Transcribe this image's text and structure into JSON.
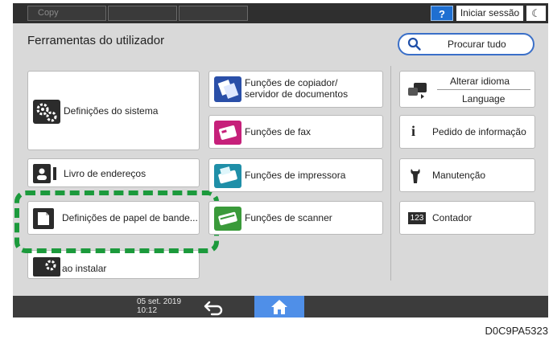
{
  "topbar": {
    "tab1_label": "Copy",
    "help_label": "?",
    "login_label": "Iniciar sessão",
    "moon_label": "☾"
  },
  "header": {
    "title": "Ferramentas do utilizador",
    "search_label": "Procurar tudo"
  },
  "left_column": {
    "system_settings": "Definições do sistema",
    "address_book": "Livro de endereços",
    "tray_paper_settings": "Definições de papel de bande...",
    "install_label": "ao instalar"
  },
  "middle_column": {
    "copier_line1": "Funções de copiador/",
    "copier_line2": "servidor de documentos",
    "fax": "Funções de fax",
    "printer": "Funções de impressora",
    "scanner": "Funções de scanner"
  },
  "right_column": {
    "change_language": "Alterar idioma",
    "language": "Language",
    "inquiry": "Pedido de informação",
    "maintenance": "Manutenção",
    "counter_badge": "123",
    "counter": "Contador"
  },
  "bottombar": {
    "date": "05 set. 2019",
    "time": "10:12"
  },
  "figure_code": "D0C9PA5323",
  "colors": {
    "highlight": "#1c9a3c",
    "accent_blue": "#1f6fd1",
    "home_button": "#4f8fe8"
  }
}
